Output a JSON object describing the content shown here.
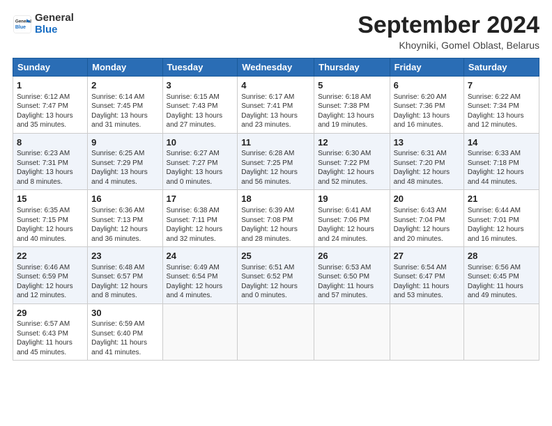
{
  "header": {
    "logo_general": "General",
    "logo_blue": "Blue",
    "month_title": "September 2024",
    "location": "Khoyniki, Gomel Oblast, Belarus"
  },
  "days_of_week": [
    "Sunday",
    "Monday",
    "Tuesday",
    "Wednesday",
    "Thursday",
    "Friday",
    "Saturday"
  ],
  "weeks": [
    [
      {
        "day": "1",
        "info": "Sunrise: 6:12 AM\nSunset: 7:47 PM\nDaylight: 13 hours\nand 35 minutes."
      },
      {
        "day": "2",
        "info": "Sunrise: 6:14 AM\nSunset: 7:45 PM\nDaylight: 13 hours\nand 31 minutes."
      },
      {
        "day": "3",
        "info": "Sunrise: 6:15 AM\nSunset: 7:43 PM\nDaylight: 13 hours\nand 27 minutes."
      },
      {
        "day": "4",
        "info": "Sunrise: 6:17 AM\nSunset: 7:41 PM\nDaylight: 13 hours\nand 23 minutes."
      },
      {
        "day": "5",
        "info": "Sunrise: 6:18 AM\nSunset: 7:38 PM\nDaylight: 13 hours\nand 19 minutes."
      },
      {
        "day": "6",
        "info": "Sunrise: 6:20 AM\nSunset: 7:36 PM\nDaylight: 13 hours\nand 16 minutes."
      },
      {
        "day": "7",
        "info": "Sunrise: 6:22 AM\nSunset: 7:34 PM\nDaylight: 13 hours\nand 12 minutes."
      }
    ],
    [
      {
        "day": "8",
        "info": "Sunrise: 6:23 AM\nSunset: 7:31 PM\nDaylight: 13 hours\nand 8 minutes."
      },
      {
        "day": "9",
        "info": "Sunrise: 6:25 AM\nSunset: 7:29 PM\nDaylight: 13 hours\nand 4 minutes."
      },
      {
        "day": "10",
        "info": "Sunrise: 6:27 AM\nSunset: 7:27 PM\nDaylight: 13 hours\nand 0 minutes."
      },
      {
        "day": "11",
        "info": "Sunrise: 6:28 AM\nSunset: 7:25 PM\nDaylight: 12 hours\nand 56 minutes."
      },
      {
        "day": "12",
        "info": "Sunrise: 6:30 AM\nSunset: 7:22 PM\nDaylight: 12 hours\nand 52 minutes."
      },
      {
        "day": "13",
        "info": "Sunrise: 6:31 AM\nSunset: 7:20 PM\nDaylight: 12 hours\nand 48 minutes."
      },
      {
        "day": "14",
        "info": "Sunrise: 6:33 AM\nSunset: 7:18 PM\nDaylight: 12 hours\nand 44 minutes."
      }
    ],
    [
      {
        "day": "15",
        "info": "Sunrise: 6:35 AM\nSunset: 7:15 PM\nDaylight: 12 hours\nand 40 minutes."
      },
      {
        "day": "16",
        "info": "Sunrise: 6:36 AM\nSunset: 7:13 PM\nDaylight: 12 hours\nand 36 minutes."
      },
      {
        "day": "17",
        "info": "Sunrise: 6:38 AM\nSunset: 7:11 PM\nDaylight: 12 hours\nand 32 minutes."
      },
      {
        "day": "18",
        "info": "Sunrise: 6:39 AM\nSunset: 7:08 PM\nDaylight: 12 hours\nand 28 minutes."
      },
      {
        "day": "19",
        "info": "Sunrise: 6:41 AM\nSunset: 7:06 PM\nDaylight: 12 hours\nand 24 minutes."
      },
      {
        "day": "20",
        "info": "Sunrise: 6:43 AM\nSunset: 7:04 PM\nDaylight: 12 hours\nand 20 minutes."
      },
      {
        "day": "21",
        "info": "Sunrise: 6:44 AM\nSunset: 7:01 PM\nDaylight: 12 hours\nand 16 minutes."
      }
    ],
    [
      {
        "day": "22",
        "info": "Sunrise: 6:46 AM\nSunset: 6:59 PM\nDaylight: 12 hours\nand 12 minutes."
      },
      {
        "day": "23",
        "info": "Sunrise: 6:48 AM\nSunset: 6:57 PM\nDaylight: 12 hours\nand 8 minutes."
      },
      {
        "day": "24",
        "info": "Sunrise: 6:49 AM\nSunset: 6:54 PM\nDaylight: 12 hours\nand 4 minutes."
      },
      {
        "day": "25",
        "info": "Sunrise: 6:51 AM\nSunset: 6:52 PM\nDaylight: 12 hours\nand 0 minutes."
      },
      {
        "day": "26",
        "info": "Sunrise: 6:53 AM\nSunset: 6:50 PM\nDaylight: 11 hours\nand 57 minutes."
      },
      {
        "day": "27",
        "info": "Sunrise: 6:54 AM\nSunset: 6:47 PM\nDaylight: 11 hours\nand 53 minutes."
      },
      {
        "day": "28",
        "info": "Sunrise: 6:56 AM\nSunset: 6:45 PM\nDaylight: 11 hours\nand 49 minutes."
      }
    ],
    [
      {
        "day": "29",
        "info": "Sunrise: 6:57 AM\nSunset: 6:43 PM\nDaylight: 11 hours\nand 45 minutes."
      },
      {
        "day": "30",
        "info": "Sunrise: 6:59 AM\nSunset: 6:40 PM\nDaylight: 11 hours\nand 41 minutes."
      },
      {
        "day": "",
        "info": ""
      },
      {
        "day": "",
        "info": ""
      },
      {
        "day": "",
        "info": ""
      },
      {
        "day": "",
        "info": ""
      },
      {
        "day": "",
        "info": ""
      }
    ]
  ]
}
